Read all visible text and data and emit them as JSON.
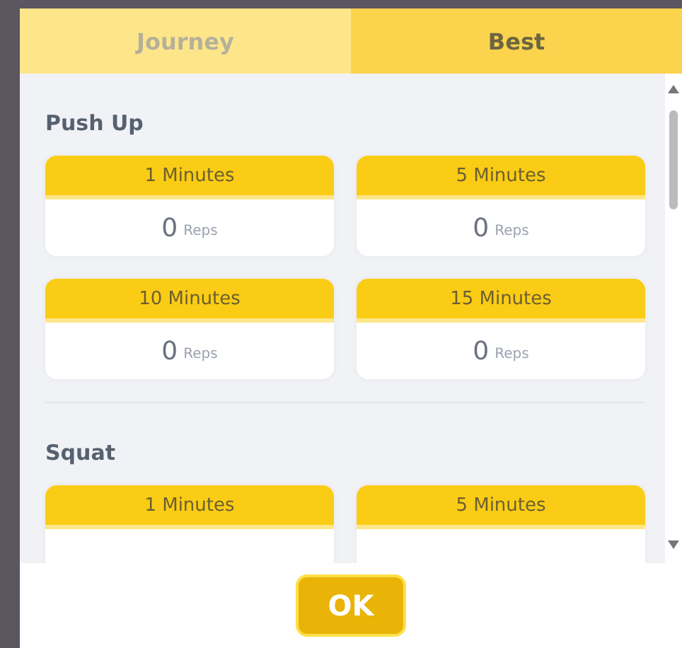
{
  "tabs": [
    {
      "label": "Journey",
      "selected": false
    },
    {
      "label": "Best",
      "selected": true
    }
  ],
  "sections": [
    {
      "title": "Push Up",
      "cards": [
        {
          "label": "1 Minutes",
          "value": "0",
          "unit": "Reps"
        },
        {
          "label": "5 Minutes",
          "value": "0",
          "unit": "Reps"
        },
        {
          "label": "10 Minutes",
          "value": "0",
          "unit": "Reps"
        },
        {
          "label": "15 Minutes",
          "value": "0",
          "unit": "Reps"
        }
      ]
    },
    {
      "title": "Squat",
      "cards": [
        {
          "label": "1 Minutes"
        },
        {
          "label": "5 Minutes"
        }
      ]
    }
  ],
  "buttons": [
    "OK"
  ]
}
